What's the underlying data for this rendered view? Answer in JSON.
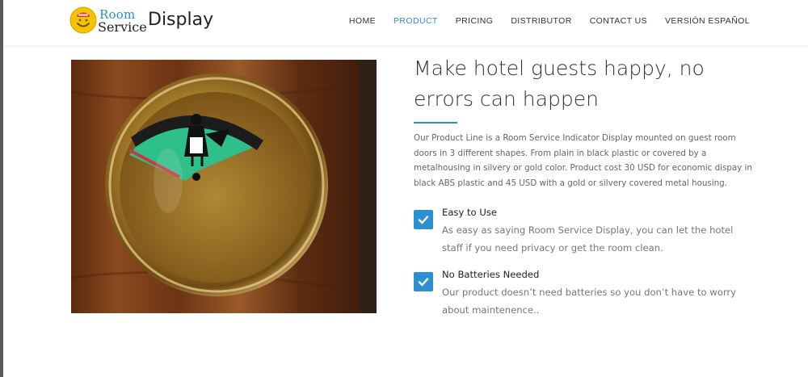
{
  "brand": {
    "room": "Room",
    "service": "Service",
    "display": "Display",
    "logo_icon": "smiley-bell-icon"
  },
  "nav": {
    "items": [
      {
        "label": "HOME",
        "active": false
      },
      {
        "label": "PRODUCT",
        "active": true
      },
      {
        "label": "PRICING",
        "active": false
      },
      {
        "label": "DISTRIBUTOR",
        "active": false
      },
      {
        "label": "CONTACT US",
        "active": false
      },
      {
        "label": "VERSIÓN ESPAÑOL",
        "active": false
      }
    ]
  },
  "main": {
    "headline": "Make hotel guests happy, no errors can happen",
    "description": "Our Product Line is a Room Service Indicator Display mounted on guest room doors in 3 different shapes. From plain in black plastic or covered by a metalhousing in silvery or gold color. Product cost 30 USD for economic dispay in black ABS plastic and 45 USD with a gold or silvery covered metal housing.",
    "features": [
      {
        "title": "Easy to Use",
        "text": "As easy as saying Room Service Display, you can let the hotel staff if you need privacy or get the room clean."
      },
      {
        "title": "No Batteries Needed",
        "text": "Our product doesn’t need batteries so you don’t have to worry about maintenence.."
      }
    ]
  },
  "colors": {
    "accent": "#2c8fd0",
    "indicator_green": "#2fbf8a"
  }
}
